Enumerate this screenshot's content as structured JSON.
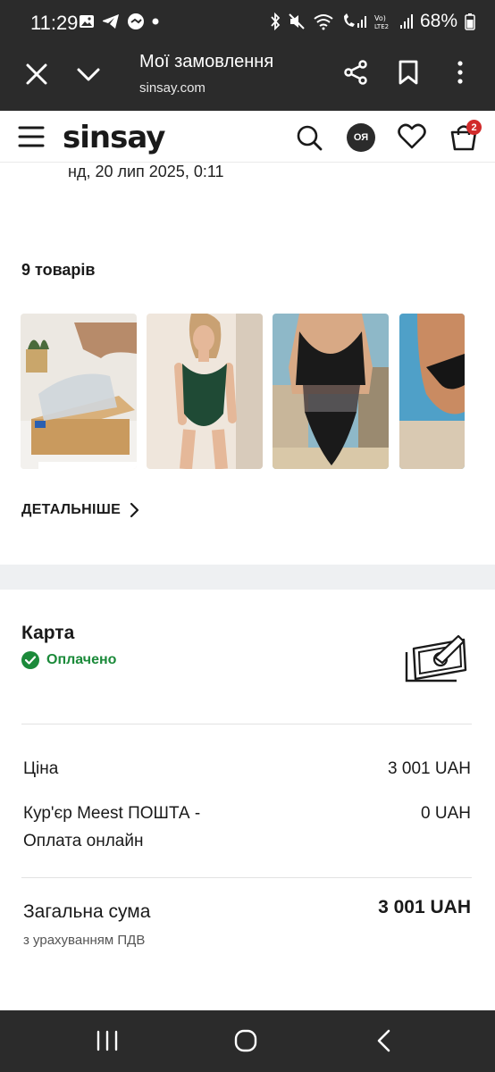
{
  "status_bar": {
    "time": "11:29",
    "battery": "68%"
  },
  "browser": {
    "title": "Мої замовлення",
    "url": "sinsay.com"
  },
  "site_header": {
    "logo": "sinsay",
    "avatar_initials": "ОЯ",
    "cart_count": "2"
  },
  "order": {
    "date": "нд, 20 лип 2025, 0:11",
    "items_count": "9 товарів",
    "details_label": "ДЕТАЛЬНІШЕ"
  },
  "payment": {
    "method": "Карта",
    "status": "Оплачено",
    "status_color": "#1b8a3a"
  },
  "summary": {
    "price_label": "Ціна",
    "price_value": "3 001 UAH",
    "delivery_label_line1": "Кур'єр Meest ПОШТА -",
    "delivery_label_line2": "Оплата онлайн",
    "delivery_value": "0 UAH",
    "total_label": "Загальна сума",
    "total_value": "3 001 UAH",
    "total_note": "з урахуванням ПДВ"
  },
  "icons": [
    "close-icon",
    "chevron-down-icon",
    "share-icon",
    "bookmark-icon",
    "more-icon",
    "menu-icon",
    "search-icon",
    "heart-icon",
    "cart-icon",
    "check-circle-icon",
    "payment-card-icon",
    "chevron-right-icon",
    "recents-icon",
    "home-icon",
    "back-icon"
  ]
}
